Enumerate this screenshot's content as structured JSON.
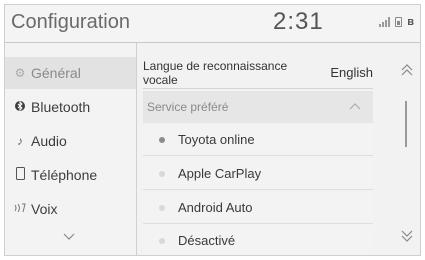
{
  "header": {
    "title": "Configuration",
    "clock": "2:31"
  },
  "status": {
    "icons": [
      "signal-icon",
      "phone-battery-icon",
      "bluetooth-icon"
    ]
  },
  "sidebar": {
    "items": [
      {
        "label": "Général",
        "icon": "gear-icon",
        "active": true
      },
      {
        "label": "Bluetooth",
        "icon": "bluetooth-icon",
        "active": false
      },
      {
        "label": "Audio",
        "icon": "music-note-icon",
        "active": false
      },
      {
        "label": "Téléphone",
        "icon": "phone-icon",
        "active": false
      },
      {
        "label": "Voix",
        "icon": "voice-icon",
        "active": false
      }
    ]
  },
  "main": {
    "voice_language": {
      "label": "Langue de reconnaissance vocale",
      "value": "English"
    },
    "preferred_service": {
      "label": "Service préféré",
      "options": [
        {
          "label": "Toyota online",
          "selected": true
        },
        {
          "label": "Apple CarPlay",
          "selected": false
        },
        {
          "label": "Android Auto",
          "selected": false
        },
        {
          "label": "Désactivé",
          "selected": false
        }
      ]
    }
  },
  "colors": {
    "background": "#f2f2f2",
    "active_item": "#e2e2e2",
    "text": "#3a3a3a",
    "muted": "#8a8a8a"
  }
}
